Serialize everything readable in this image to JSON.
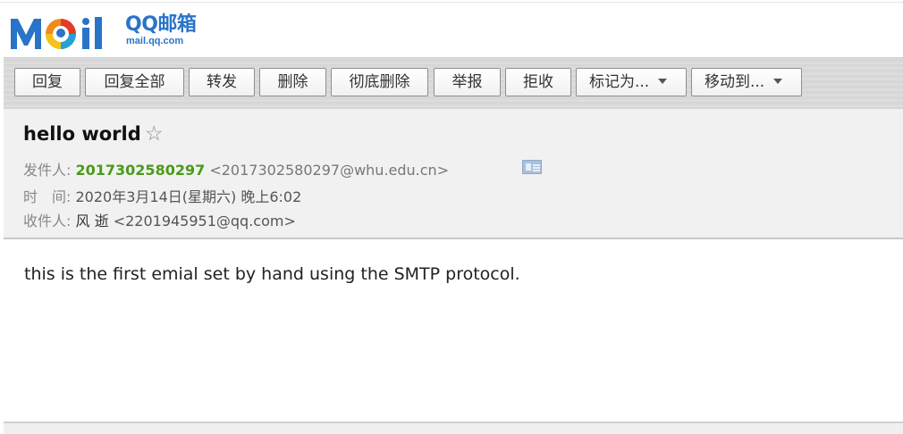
{
  "logo": {
    "text": "MOil",
    "brand": "QQ邮箱",
    "domain": "mail.qq.com"
  },
  "toolbar": {
    "reply": "回复",
    "reply_all": "回复全部",
    "forward": "转发",
    "delete": "删除",
    "delete_permanently": "彻底删除",
    "report": "举报",
    "reject": "拒收",
    "mark_as": "标记为...",
    "move_to": "移动到..."
  },
  "email": {
    "subject": "hello world",
    "from_label": "发件人:",
    "from_name": "2017302580297",
    "from_address": "<2017302580297@whu.edu.cn>",
    "time_label": "时　间:",
    "time_value": "2020年3月14日(星期六) 晚上6:02",
    "to_label": "收件人:",
    "to_name": "风 逝",
    "to_address": "<2201945951@qq.com>",
    "body": "this is the first emial set by hand using the SMTP protocol."
  },
  "colors": {
    "brand_blue": "#2a74c8",
    "sender_green": "#4a9a1a"
  }
}
